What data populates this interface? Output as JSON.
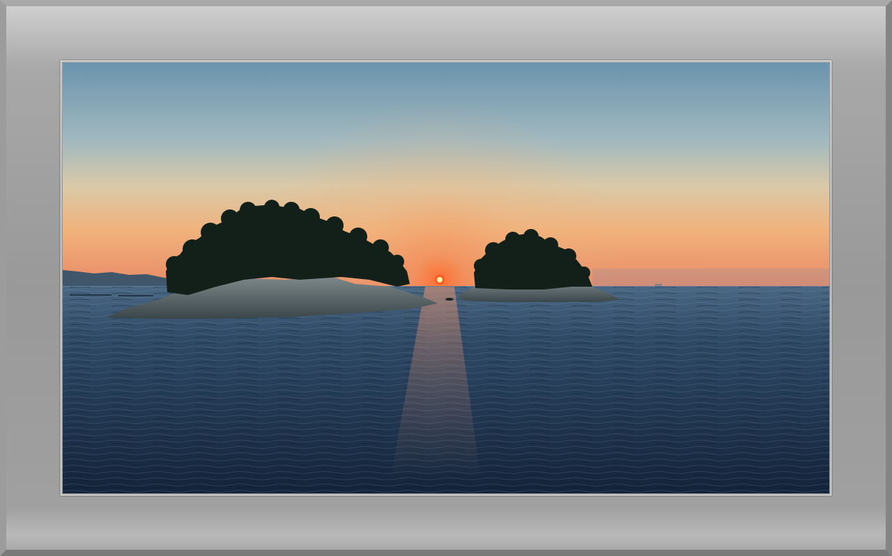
{
  "photo": {
    "subject": "sunset-over-sea-with-two-islands",
    "colors": {
      "sky_top": "#6a93ad",
      "sky_mid": "#b9c7c3",
      "sky_glow": "#f0b27a",
      "horizon_orange": "#f07a4a",
      "sun": "#ff5a1f",
      "sun_core": "#fff2b0",
      "sea_top": "#3d5a74",
      "sea_bottom": "#14243a",
      "island_silhouette": "#142019",
      "rock": "#5e6b6f",
      "mountains": "#3e5163",
      "frame_light": "#cfcfcf",
      "frame_dark": "#8a8a8a",
      "mat_line": "#f2f2f2"
    }
  }
}
